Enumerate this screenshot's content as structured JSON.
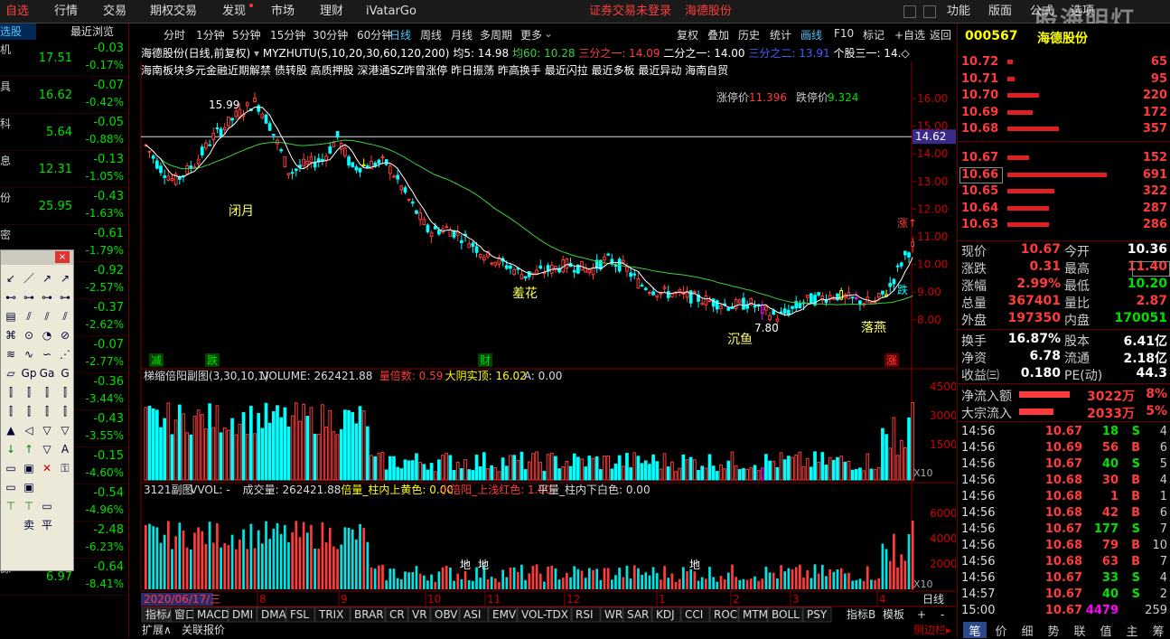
{
  "menubar": {
    "items": [
      "自选",
      "行情",
      "交易",
      "期权交易",
      "发现",
      "市场",
      "理财",
      "iVatarGo"
    ],
    "status_text": "证券交易未登录",
    "stock_link": "海德股份",
    "right_items": [
      "功能",
      "版面",
      "公式",
      "选项"
    ],
    "watermark": "股海明灯"
  },
  "left_list": {
    "header_left": "选股",
    "header_right": "最近浏览",
    "rows": [
      {
        "name": "机",
        "price": "17.51",
        "change": "-0.03",
        "pct": "-0.17%"
      },
      {
        "name": "具",
        "price": "16.62",
        "change": "-0.07",
        "pct": "-0.42%"
      },
      {
        "name": "科",
        "price": "5.64",
        "change": "-0.05",
        "pct": "-0.88%"
      },
      {
        "name": "息",
        "price": "12.31",
        "change": "-0.13",
        "pct": "-1.05%"
      },
      {
        "name": "份",
        "price": "25.95",
        "change": "-0.43",
        "pct": "-1.63%"
      },
      {
        "name": "密",
        "price": "",
        "change": "-0.61",
        "pct": "-1.79%"
      },
      {
        "name": "",
        "price": "",
        "change": "-0.92",
        "pct": "-2.57%"
      },
      {
        "name": "",
        "price": "",
        "change": "-0.37",
        "pct": "-2.62%"
      },
      {
        "name": "",
        "price": "",
        "change": "-0.07",
        "pct": "-2.77%"
      },
      {
        "name": "",
        "price": "",
        "change": "-0.36",
        "pct": "-3.44%"
      },
      {
        "name": "",
        "price": "",
        "change": "-0.43",
        "pct": "-3.55%"
      },
      {
        "name": "",
        "price": "",
        "change": "-0.15",
        "pct": "-4.60%"
      },
      {
        "name": "",
        "price": "",
        "change": "-0.54",
        "pct": "-4.96%"
      },
      {
        "name": "",
        "price": "",
        "change": "-2.48",
        "pct": "-6.23%"
      },
      {
        "name": "源",
        "price": "6.97",
        "change": "-0.64",
        "pct": "-8.41%"
      }
    ]
  },
  "period_tabs": [
    "分时",
    "1分钟",
    "5分钟",
    "15分钟",
    "30分钟",
    "60分钟",
    "日线",
    "周线",
    "月线",
    "多周期",
    "更多"
  ],
  "active_period": "日线",
  "chart_tools": [
    "复权",
    "叠加",
    "历史",
    "统计",
    "画线",
    "F10",
    "标记",
    "+自选",
    "返回"
  ],
  "stock_bar": {
    "title": "海德股份(日线,前复权)",
    "indicator": "MYZHUTU(5,10,20,30,60,120,200)",
    "ma5": "均5: 14.98",
    "ma60": "均60: 10.28",
    "third1": "三分之一: 14.09",
    "half": "二分之一: 14.00",
    "third2": "三分之二: 13.91",
    "third3": "个股三一: 14.◇"
  },
  "tagline": "海南板块多元金融近期解禁 债转股 高质押股 深港通SZ昨曾涨停 昨日振荡 昨高换手 最近闪拉 最近多板 最近异动 海南自贸",
  "limit_up_label": "涨停价",
  "limit_up": "11.396",
  "limit_down_label": "跌停价",
  "limit_down": "9.324",
  "price_axis": [
    "16.00",
    "15.00",
    "14.00",
    "13.00",
    "12.00",
    "11.00",
    "10.00",
    "9.00",
    "8.00"
  ],
  "price_marker": "14.62",
  "annotations": {
    "high": "15.99",
    "low": "7.80",
    "a1": "闭月",
    "a2": "羞花",
    "a3": "沉鱼",
    "a4": "落燕",
    "rise": "涨↑",
    "fall": "跌",
    "bottom_tags": [
      "减",
      "跌",
      "财",
      "涨"
    ]
  },
  "volume_panel": {
    "label": "梯缩倍阳副图(3,30,10,1)",
    "volume": "VOLUME: 262421.88",
    "ratio_label": "量倍数: 0.59",
    "big_label": "大阴实顶: 16.02",
    "a_label": "A: 0.00",
    "axis": [
      "45000",
      "30000",
      "15000"
    ],
    "unit": "X10"
  },
  "sub_panel": {
    "label": "3121副图",
    "vvol": "VVOL: -",
    "vol": "成交量: 262421.88",
    "x1": "倍量_柱内上黄色: 0.00",
    "x2": "小倍阳_上浅红色: 1.00",
    "x3": "平量_柱内下白色: 0.00",
    "axis": [
      "60000",
      "40000",
      "20000"
    ],
    "unit": "X10",
    "marks": [
      "地",
      "地",
      "地"
    ]
  },
  "date_axis": {
    "first": "2020/06/17/三",
    "months": [
      "8",
      "9",
      "10",
      "11",
      "12",
      "1",
      "2",
      "3",
      "4"
    ],
    "period": "日线"
  },
  "indicator_tabs": [
    "指标A",
    "窗口",
    "MACD",
    "DMI",
    "DMA",
    "FSL",
    "TRIX",
    "BRAR",
    "CR",
    "VR",
    "OBV",
    "ASI",
    "EMV",
    "VOL-TDX",
    "RSI",
    "WR",
    "SAR",
    "KDJ",
    "CCI",
    "ROC",
    "MTM",
    "BOLL",
    "PSY"
  ],
  "indicator_right": [
    "指标B",
    "模板",
    "+",
    "-"
  ],
  "bottom_left": [
    "扩展∧",
    "关联报价"
  ],
  "side_bar_label": "侧边栏▸",
  "quote": {
    "code": "000567",
    "name": "海德股份",
    "sells": [
      {
        "price": "10.72",
        "vol": "65",
        "w": 0.05
      },
      {
        "price": "10.71",
        "vol": "95",
        "w": 0.07
      },
      {
        "price": "10.70",
        "vol": "220",
        "w": 0.32
      },
      {
        "price": "10.69",
        "vol": "172",
        "w": 0.25
      },
      {
        "price": "10.68",
        "vol": "357",
        "w": 0.52
      }
    ],
    "buys": [
      {
        "price": "10.67",
        "vol": "152",
        "w": 0.22
      },
      {
        "price": "10.66",
        "vol": "691",
        "w": 1.0
      },
      {
        "price": "10.65",
        "vol": "322",
        "w": 0.47
      },
      {
        "price": "10.64",
        "vol": "287",
        "w": 0.42
      },
      {
        "price": "10.63",
        "vol": "286",
        "w": 0.42
      }
    ],
    "stats": [
      {
        "k": "现价",
        "v": "10.67",
        "k2": "今开",
        "v2": "10.36"
      },
      {
        "k": "涨跌",
        "v": "0.31",
        "k2": "最高",
        "v2": "11.40"
      },
      {
        "k": "涨幅",
        "v": "2.99%",
        "k2": "最低",
        "v2": "10.20"
      },
      {
        "k": "总量",
        "v": "367401",
        "k2": "量比",
        "v2": "2.87"
      },
      {
        "k": "外盘",
        "v": "197350",
        "k2": "内盘",
        "v2": "170051"
      }
    ],
    "stats2": [
      {
        "k": "换手",
        "v": "16.87%",
        "k2": "股本",
        "v2": "6.41亿"
      },
      {
        "k": "净资",
        "v": "6.78",
        "k2": "流通",
        "v2": "2.18亿"
      },
      {
        "k": "收益㈢",
        "v": "0.180",
        "k2": "PE(动)",
        "v2": "44.3"
      }
    ],
    "flows": [
      {
        "k": "净流入额",
        "v": "3022万",
        "p": "8%"
      },
      {
        "k": "大宗流入",
        "v": "2033万",
        "p": "5%"
      }
    ],
    "ticks": [
      {
        "t": "14:56",
        "p": "10.67",
        "v": "18",
        "s": "S",
        "n": "4"
      },
      {
        "t": "14:56",
        "p": "10.69",
        "v": "56",
        "s": "B",
        "n": "6"
      },
      {
        "t": "14:56",
        "p": "10.67",
        "v": "40",
        "s": "S",
        "n": "5"
      },
      {
        "t": "14:56",
        "p": "10.68",
        "v": "30",
        "s": "B",
        "n": "4"
      },
      {
        "t": "14:56",
        "p": "10.68",
        "v": "1",
        "s": "B",
        "n": "1"
      },
      {
        "t": "14:56",
        "p": "10.68",
        "v": "42",
        "s": "B",
        "n": "6"
      },
      {
        "t": "14:56",
        "p": "10.67",
        "v": "177",
        "s": "S",
        "n": "7"
      },
      {
        "t": "14:56",
        "p": "10.68",
        "v": "79",
        "s": "B",
        "n": "10"
      },
      {
        "t": "14:56",
        "p": "10.68",
        "v": "63",
        "s": "B",
        "n": "7"
      },
      {
        "t": "14:56",
        "p": "10.67",
        "v": "33",
        "s": "S",
        "n": "4"
      },
      {
        "t": "14:57",
        "p": "10.67",
        "v": "40",
        "s": "S",
        "n": "2"
      },
      {
        "t": "15:00",
        "p": "10.67",
        "v": "4479",
        "s": "",
        "n": "259"
      }
    ],
    "bottom_tabs": [
      "笔",
      "价",
      "细",
      "势",
      "联",
      "值",
      "主",
      "筹"
    ]
  },
  "colors": {
    "up": "#ff3b3b",
    "down": "#00e000",
    "cyan": "#00ffff",
    "ma60": "#3fcf3f",
    "ma5": "#ffffff",
    "magenta": "#ff00ff",
    "yellow": "#ffff00"
  }
}
